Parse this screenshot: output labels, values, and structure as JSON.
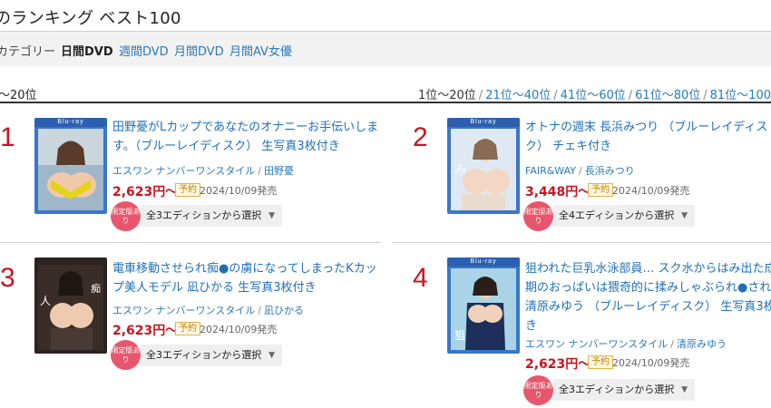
{
  "page_title": "のランキング ベスト100",
  "category": {
    "label": "カテゴリー",
    "active": "日間DVD",
    "links": [
      "週間DVD",
      "月間DVD",
      "月間AV女優"
    ]
  },
  "range_current": "〜20位",
  "pager": {
    "current": "1位〜20位",
    "links": [
      "21位〜40位",
      "41位〜60位",
      "61位〜80位",
      "81位〜100"
    ]
  },
  "items": [
    {
      "rank": "1",
      "title": "田野憂がLカップであなたのオナニーお手伝いします。（ブルーレイディスク） 生写真3枚付き",
      "maker": "エスワン ナンバーワンスタイル",
      "actress": "田野憂",
      "price": "2,623円〜",
      "badge": "予約",
      "date": "2024/10/09発売",
      "limited": "限定版あり",
      "edition": "全3エディションから選択"
    },
    {
      "rank": "2",
      "title": "オトナの週末 長浜みつり （ブルーレイディスク） チェキ付き",
      "maker": "FAIR&WAY",
      "actress": "長浜みつり",
      "price": "3,448円〜",
      "badge": "予約",
      "date": "2024/10/09発売",
      "limited": "限定版あり",
      "edition": "全4エディションから選択"
    },
    {
      "rank": "3",
      "title": "電車移動させられ痴●の虜になってしまったKカップ美人モデル 凪ひかる 生写真3枚付き",
      "maker": "エスワン ナンバーワンスタイル",
      "actress": "凪ひかる",
      "price": "2,623円〜",
      "badge": "予約",
      "date": "2024/10/09発売",
      "limited": "限定版あり",
      "edition": "全3エディションから選択"
    },
    {
      "rank": "4",
      "title": "狙われた巨乳水泳部員… スク水からはみ出た成期のおっぱいは猥奇的に揉みしゃぶられ●され清原みゆう （ブルーレイディスク） 生写真3枚き",
      "maker": "エスワン ナンバーワンスタイル",
      "actress": "清原みゆう",
      "price": "2,623円〜",
      "badge": "予約",
      "date": "2024/10/09発売",
      "limited": "限定版あり",
      "edition": "全3エディションから選択"
    }
  ],
  "colors": {
    "rank": "#c8141e",
    "link": "#2a7ab8",
    "cover": "#3a76c9",
    "limited": "#e8566d"
  }
}
